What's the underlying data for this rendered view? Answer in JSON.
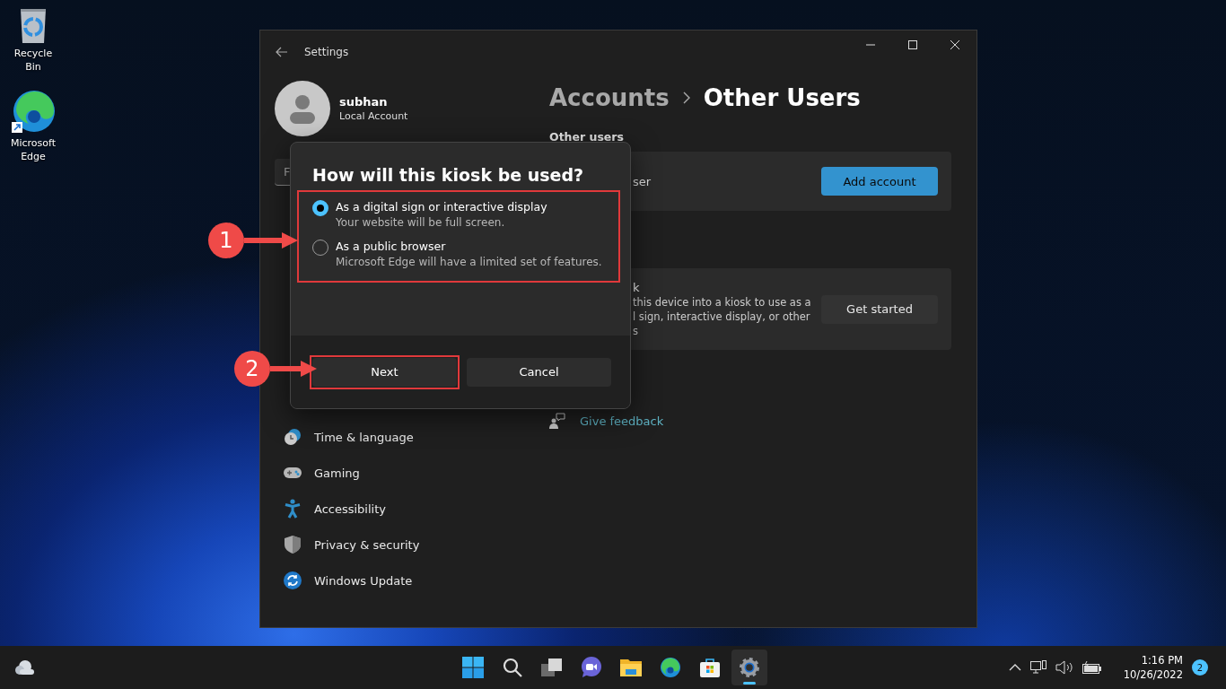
{
  "desktop": {
    "icons": [
      {
        "label": "Recycle Bin",
        "kind": "recycle"
      },
      {
        "label": "Microsoft Edge",
        "kind": "edge"
      }
    ]
  },
  "window": {
    "title": "Settings"
  },
  "profile": {
    "name": "subhan",
    "account_type": "Local Account"
  },
  "search": {
    "value": "F"
  },
  "sidebar": {
    "items": [
      {
        "label": "Time & language",
        "kind": "time"
      },
      {
        "label": "Gaming",
        "kind": "gaming"
      },
      {
        "label": "Accessibility",
        "kind": "accessibility"
      },
      {
        "label": "Privacy & security",
        "kind": "privacy"
      },
      {
        "label": "Windows Update",
        "kind": "update"
      }
    ]
  },
  "breadcrumb": {
    "parent": "Accounts",
    "current": "Other Users"
  },
  "section_title": "Other users",
  "add_user_card": {
    "label": "ser",
    "button": "Add account"
  },
  "kiosk_card": {
    "lines": [
      "k",
      "this device into a kiosk to use as a",
      "l sign, interactive display, or other",
      "s"
    ],
    "button": "Get started"
  },
  "feedback_link": "Give feedback",
  "dialog": {
    "title": "How will this kiosk be used?",
    "options": [
      {
        "label": "As a digital sign or interactive display",
        "description": "Your website will be full screen.",
        "selected": true
      },
      {
        "label": "As a public browser",
        "description": "Microsoft Edge will have a limited set of features.",
        "selected": false
      }
    ],
    "buttons": [
      "Next",
      "Cancel"
    ]
  },
  "callouts": [
    {
      "number": "1"
    },
    {
      "number": "2"
    }
  ],
  "taskbar": {
    "apps": [
      {
        "kind": "start",
        "selected": false
      },
      {
        "kind": "search",
        "selected": false
      },
      {
        "kind": "taskview",
        "selected": false
      },
      {
        "kind": "chat",
        "selected": false
      },
      {
        "kind": "explorer",
        "selected": false
      },
      {
        "kind": "edge",
        "selected": false
      },
      {
        "kind": "store",
        "selected": false
      },
      {
        "kind": "settings",
        "selected": true
      }
    ],
    "time": "1:16 PM",
    "date": "10/26/2022",
    "notification_count": "2"
  }
}
